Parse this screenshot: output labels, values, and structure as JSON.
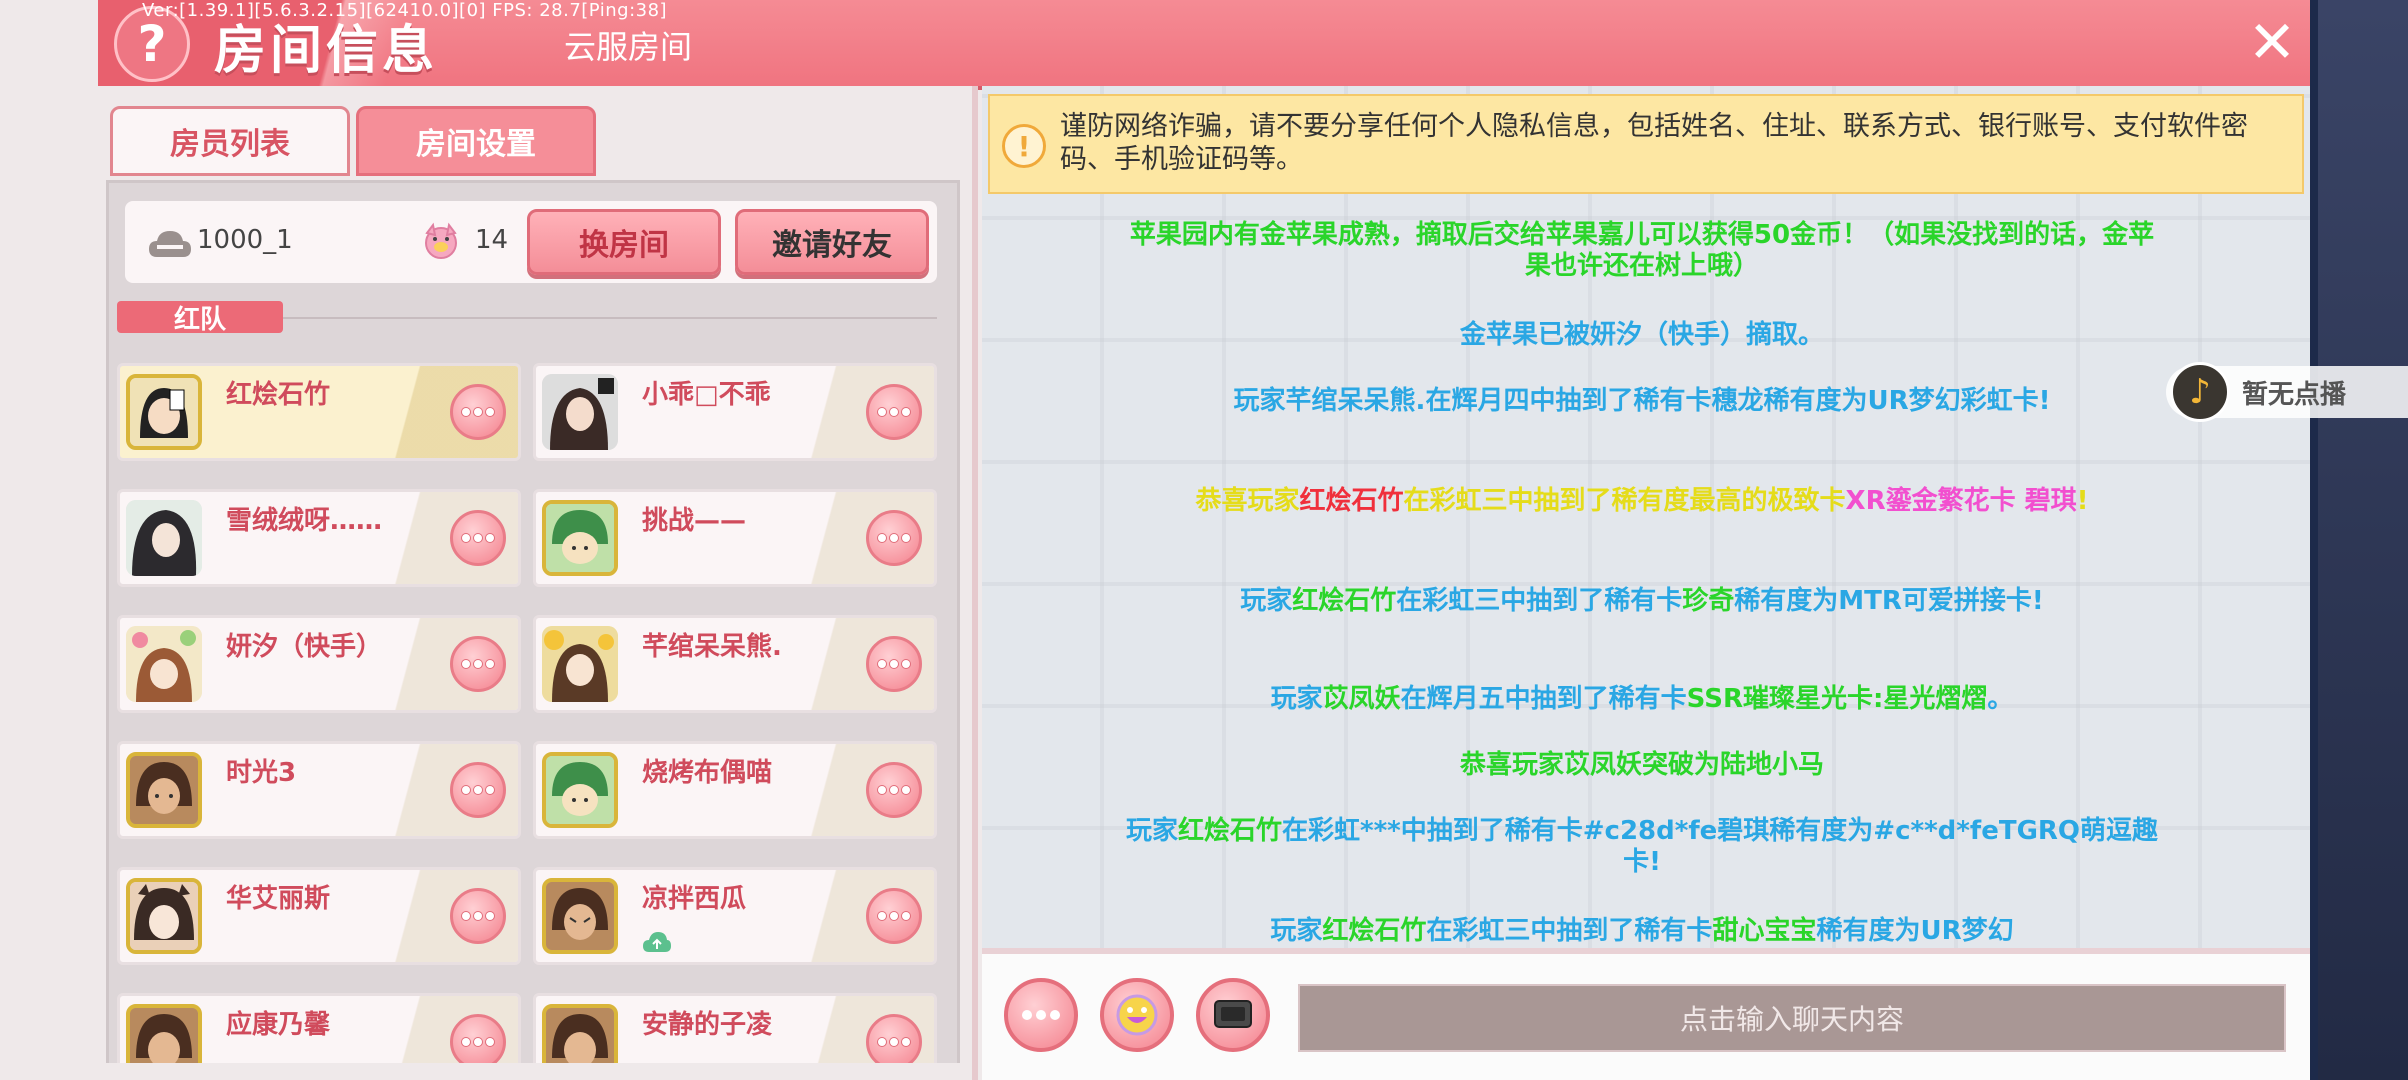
{
  "debug": {
    "version_text": "Ver:[1.39.1][5.6.3.2.15][62410.0][0] FPS: 28.7[Ping:38]"
  },
  "header": {
    "help_glyph": "?",
    "title": "房间信息",
    "subtitle": "云服房间",
    "close_glyph": "✕"
  },
  "tabs": [
    {
      "label": "房员列表"
    },
    {
      "label": "房间设置"
    }
  ],
  "room": {
    "id": "1000_1",
    "player_count": "14",
    "change_room_label": "换房间",
    "invite_label": "邀请好友"
  },
  "team": {
    "label": "红队"
  },
  "members": [
    {
      "name": "红烩石竹",
      "highlight": true
    },
    {
      "name": "小乖□不乖"
    },
    {
      "name": "雪绒绒呀……"
    },
    {
      "name": "挑战——"
    },
    {
      "name": "妍汐（快手）"
    },
    {
      "name": "芊绾呆呆熊."
    },
    {
      "name": "时光3"
    },
    {
      "name": "烧烤布偶喵"
    },
    {
      "name": "华艾丽斯"
    },
    {
      "name": "凉拌西瓜"
    },
    {
      "name": "应康乃馨"
    },
    {
      "name": "安静的子凌"
    }
  ],
  "warning": {
    "icon": "!",
    "text": "谨防网络诈骗，请不要分享任何个人隐私信息，包括姓名、住址、联系方式、银行账号、支付软件密码、手机验证码等。"
  },
  "messages": [
    {
      "segments": [
        {
          "t": "苹果园内有金苹果成熟，摘取后交给苹果嘉儿可以获得50金币！（如果没找到的话，金苹果也许还在树上哦）",
          "c": "green"
        }
      ]
    },
    {
      "segments": [
        {
          "t": "金苹果已被妍汐（快手）摘取。",
          "c": "blue"
        }
      ]
    },
    {
      "segments": [
        {
          "t": "玩家",
          "c": "blue"
        },
        {
          "t": "芊绾呆呆熊.",
          "c": "blue"
        },
        {
          "t": "在辉月四中抽到了稀有卡",
          "c": "blue"
        },
        {
          "t": "穗龙",
          "c": "blue"
        },
        {
          "t": "稀有度为UR梦幻彩虹卡!",
          "c": "blue"
        }
      ]
    },
    {
      "segments": [
        {
          "t": "恭喜玩家",
          "c": "yellow"
        },
        {
          "t": "红烩石竹",
          "c": "red"
        },
        {
          "t": "在彩虹三中抽到了稀有度最高的极致卡",
          "c": "yellow"
        },
        {
          "t": "XR鎏金繁花卡 碧琪",
          "c": "pink"
        },
        {
          "t": "!",
          "c": "yellow"
        }
      ]
    },
    {
      "segments": [
        {
          "t": "玩家",
          "c": "blue"
        },
        {
          "t": "红烩石竹",
          "c": "green"
        },
        {
          "t": "在彩虹三中抽到了稀有卡",
          "c": "blue"
        },
        {
          "t": "珍奇",
          "c": "green"
        },
        {
          "t": "稀有度为MTR可爱拼接卡!",
          "c": "blue"
        }
      ]
    },
    {
      "segments": [
        {
          "t": "玩家",
          "c": "blue"
        },
        {
          "t": "苡凤妖",
          "c": "green"
        },
        {
          "t": "在辉月五中抽到了稀有卡",
          "c": "blue"
        },
        {
          "t": "SSR璀璨星光卡:星光熠熠",
          "c": "green"
        },
        {
          "t": "。",
          "c": "blue"
        }
      ]
    },
    {
      "segments": [
        {
          "t": "恭喜玩家苡凤妖突破为陆地小马",
          "c": "green"
        }
      ]
    },
    {
      "segments": [
        {
          "t": "玩家",
          "c": "blue"
        },
        {
          "t": "红烩石竹",
          "c": "green"
        },
        {
          "t": "在彩虹***中抽到了稀有卡#c28d*fe碧琪稀有度为#c**d*feTGRQ萌逗趣卡!",
          "c": "blue"
        }
      ]
    },
    {
      "segments": [
        {
          "t": "玩家",
          "c": "blue"
        },
        {
          "t": "红烩石竹",
          "c": "green"
        },
        {
          "t": "在彩虹三中抽到了稀有卡",
          "c": "blue"
        },
        {
          "t": "甜心宝宝",
          "c": "green"
        },
        {
          "t": "稀有度为UR梦幻",
          "c": "blue"
        }
      ]
    }
  ],
  "input": {
    "placeholder": "点击输入聊天内容"
  },
  "music": {
    "label": "暂无点播",
    "icon": "♪"
  },
  "colors": {
    "header": "#f07480",
    "accent": "#e56f7c",
    "warning_bg": "#fde7a3",
    "green": "#2ad52a",
    "blue": "#2aa7e4",
    "pink": "#f24fcf",
    "yellow": "#e5dc1a"
  }
}
